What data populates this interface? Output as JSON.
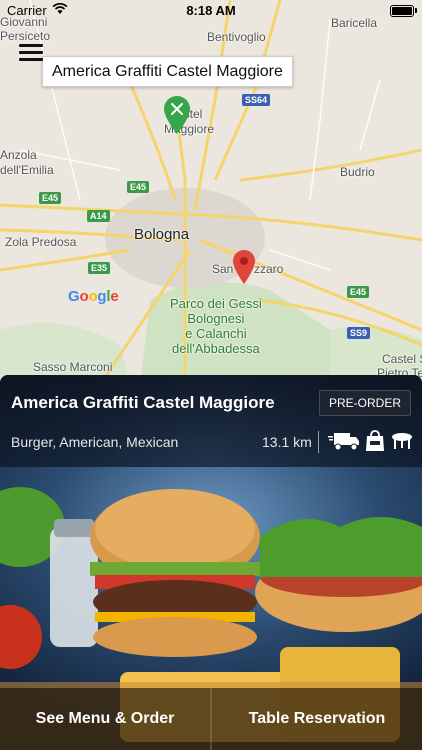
{
  "status_bar": {
    "carrier": "Carrier",
    "time": "8:18 AM"
  },
  "map": {
    "callout_title": "America Graffiti Castel Maggiore",
    "places": {
      "giovanni": "Giovanni",
      "persiceto": "Persiceto",
      "bentivoglio": "Bentivoglio",
      "baricella": "Baricella",
      "castel_maggiore_1": "astel",
      "castel_maggiore_2": "Maggiore",
      "anzola": "Anzola",
      "emilia": "dell'Emilia",
      "budrio": "Budrio",
      "zola": "Zola Predosa",
      "bologna": "Bologna",
      "san_lazzaro_1": "San",
      "san_lazzaro_2": "zzaro",
      "park_1": "Parco dei Gessi",
      "park_2": "Bolognesi",
      "park_3": "e Calanchi",
      "park_4": "dell'Abbadessa",
      "sasso": "Sasso Marconi",
      "castel_s": "Castel S",
      "pietro": "Pietro Te"
    },
    "roads": {
      "ss64": "SS64",
      "e45_a": "E45",
      "e45_b": "E45",
      "a14": "A14",
      "e35": "E35",
      "e45_c": "E45",
      "ss9": "SS9"
    },
    "logo_letters": [
      "G",
      "o",
      "o",
      "g",
      "l",
      "e"
    ]
  },
  "restaurant": {
    "name": "America Graffiti Castel Maggiore",
    "badge": "PRE-ORDER",
    "cuisine": "Burger, American, Mexican",
    "distance": "13.1 km",
    "services": [
      "delivery-truck-icon",
      "takeaway-bag-icon",
      "dine-in-table-icon"
    ]
  },
  "actions": {
    "menu": "See Menu & Order",
    "reservation": "Table Reservation"
  },
  "colors": {
    "pin_green": "#37a64a",
    "pin_red": "#e0453a",
    "panel_dark": "#0c121e"
  }
}
